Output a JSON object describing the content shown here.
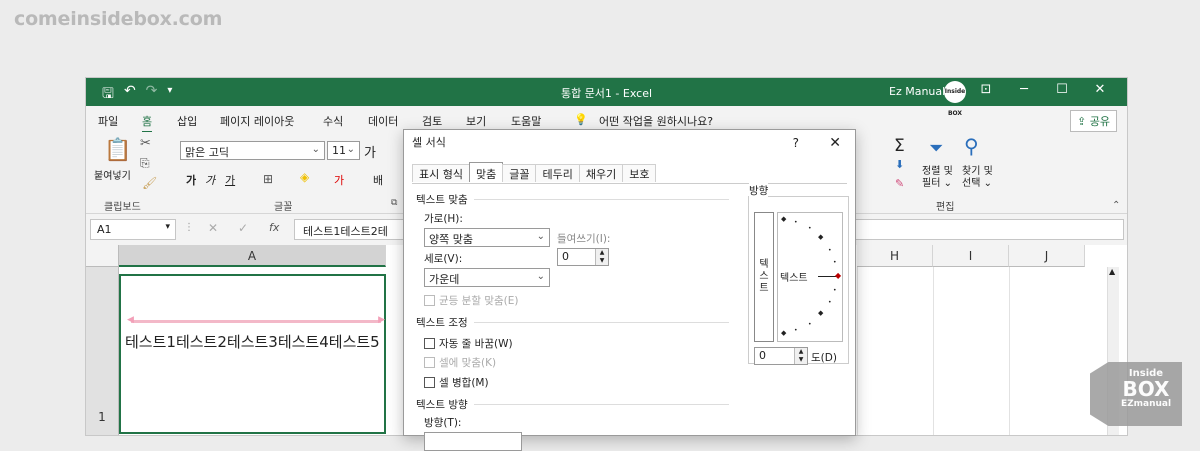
{
  "watermark": "comeinsidebox.com",
  "titlebar": {
    "title": "통합 문서1 - Excel",
    "user": "Ez Manual",
    "avatar": "Inside BOX"
  },
  "menu": {
    "tabs": [
      "파일",
      "홈",
      "삽입",
      "페이지 레이아웃",
      "수식",
      "데이터",
      "검토",
      "보기",
      "도움말"
    ],
    "search": "어떤 작업을 원하시나요?",
    "share": "공유"
  },
  "ribbon": {
    "paste": "붙여넣기",
    "clipboard": "클립보드",
    "font_name": "맑은 고딕",
    "font_size": "11",
    "font_group": "글꼴",
    "sort_filter": "정렬 및 필터 ⌄",
    "find_select": "찾기 및 선택 ⌄",
    "edit_group": "편집"
  },
  "formula": {
    "namebox": "A1",
    "content": "테스트1테스트2테"
  },
  "grid": {
    "cols": [
      "A",
      "H",
      "I",
      "J"
    ],
    "row1": "1",
    "cellA1": "테스트1테스트2테스트3테스트4테스트5"
  },
  "dialog": {
    "title": "셀 서식",
    "help": "?",
    "close": "✕",
    "tabs": [
      "표시 형식",
      "맞춤",
      "글꼴",
      "테두리",
      "채우기",
      "보호"
    ],
    "text_align_section": "텍스트 맞춤",
    "horizontal_label": "가로(H):",
    "horizontal_value": "양쪽 맞춤",
    "indent_label": "들여쓰기(I):",
    "indent_value": "0",
    "vertical_label": "세로(V):",
    "vertical_value": "가운데",
    "distributed": "균등 분할 맞춤(E)",
    "text_control_section": "텍스트 조정",
    "wrap_text": "자동 줄 바꿈(W)",
    "shrink_fit": "셀에 맞춤(K)",
    "merge_cells": "셀 병합(M)",
    "text_dir_section": "텍스트 방향",
    "direction_label": "방향(T):",
    "orientation_section": "방향",
    "vertical_text": "텍\n스\n트",
    "orient_text": "텍스트",
    "degree_value": "0",
    "degree_label": "도(D)"
  },
  "badge": {
    "line1": "Inside",
    "line2": "BOX",
    "line3": "EZmanual"
  }
}
